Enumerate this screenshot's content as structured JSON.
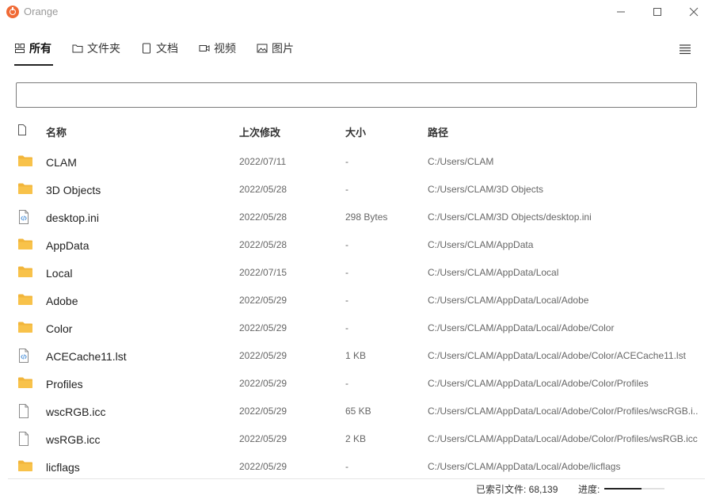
{
  "app": {
    "title": "Orange"
  },
  "tabs": [
    {
      "label": "所有",
      "icon": "all-icon",
      "active": true
    },
    {
      "label": "文件夹",
      "icon": "folder-icon",
      "active": false
    },
    {
      "label": "文档",
      "icon": "document-icon",
      "active": false
    },
    {
      "label": "视频",
      "icon": "video-icon",
      "active": false
    },
    {
      "label": "图片",
      "icon": "image-icon",
      "active": false
    }
  ],
  "search": {
    "value": "",
    "placeholder": ""
  },
  "table": {
    "headers": {
      "name": "名称",
      "date": "上次修改",
      "size": "大小",
      "path": "路径"
    },
    "rows": [
      {
        "type": "folder",
        "name": "CLAM",
        "date": "2022/07/11",
        "size": "-",
        "path": "C:/Users/CLAM"
      },
      {
        "type": "folder",
        "name": "3D Objects",
        "date": "2022/05/28",
        "size": "-",
        "path": "C:/Users/CLAM/3D Objects"
      },
      {
        "type": "code",
        "name": "desktop.ini",
        "date": "2022/05/28",
        "size": "298 Bytes",
        "path": "C:/Users/CLAM/3D Objects/desktop.ini"
      },
      {
        "type": "folder",
        "name": "AppData",
        "date": "2022/05/28",
        "size": "-",
        "path": "C:/Users/CLAM/AppData"
      },
      {
        "type": "folder",
        "name": "Local",
        "date": "2022/07/15",
        "size": "-",
        "path": "C:/Users/CLAM/AppData/Local"
      },
      {
        "type": "folder",
        "name": "Adobe",
        "date": "2022/05/29",
        "size": "-",
        "path": "C:/Users/CLAM/AppData/Local/Adobe"
      },
      {
        "type": "folder",
        "name": "Color",
        "date": "2022/05/29",
        "size": "-",
        "path": "C:/Users/CLAM/AppData/Local/Adobe/Color"
      },
      {
        "type": "code",
        "name": "ACECache11.lst",
        "date": "2022/05/29",
        "size": "1 KB",
        "path": "C:/Users/CLAM/AppData/Local/Adobe/Color/ACECache11.lst"
      },
      {
        "type": "folder",
        "name": "Profiles",
        "date": "2022/05/29",
        "size": "-",
        "path": "C:/Users/CLAM/AppData/Local/Adobe/Color/Profiles"
      },
      {
        "type": "file",
        "name": "wscRGB.icc",
        "date": "2022/05/29",
        "size": "65 KB",
        "path": "C:/Users/CLAM/AppData/Local/Adobe/Color/Profiles/wscRGB.i..."
      },
      {
        "type": "file",
        "name": "wsRGB.icc",
        "date": "2022/05/29",
        "size": "2 KB",
        "path": "C:/Users/CLAM/AppData/Local/Adobe/Color/Profiles/wsRGB.icc"
      },
      {
        "type": "folder",
        "name": "licflags",
        "date": "2022/05/29",
        "size": "-",
        "path": "C:/Users/CLAM/AppData/Local/Adobe/licflags"
      }
    ]
  },
  "status": {
    "indexed_label": "已索引文件: 68,139",
    "progress_label": "进度:",
    "progress_fraction": 0.62
  },
  "colors": {
    "accent": "#f06a35",
    "folder": "#f8c24a",
    "folder_dark": "#f2b53a",
    "file_outline": "#8a8a8a",
    "code_accent": "#4a90d9"
  }
}
